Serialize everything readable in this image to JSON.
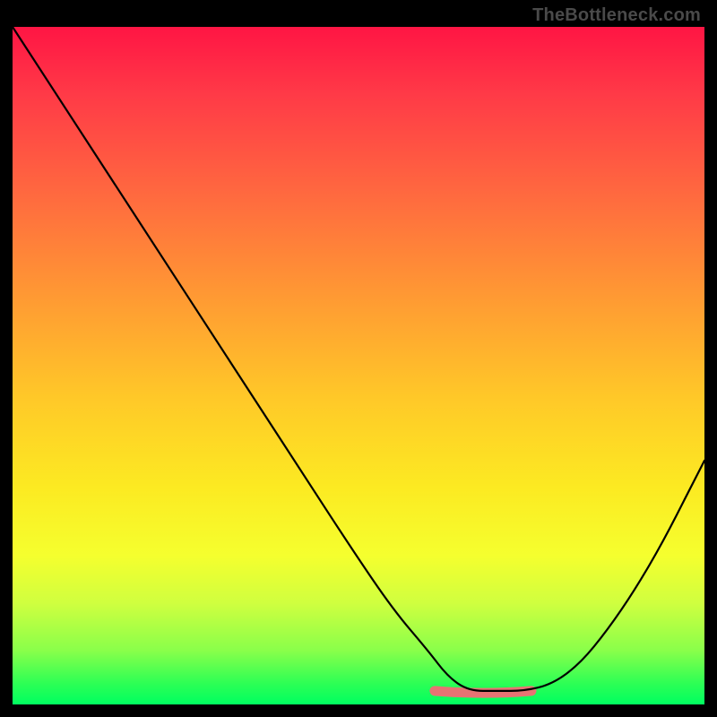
{
  "brand": "TheBottleneck.com",
  "colors": {
    "gradient_top": "#ff1544",
    "gradient_mid1": "#ff9a33",
    "gradient_mid2": "#fcea22",
    "gradient_bottom": "#00ff60",
    "curve": "#000000",
    "highlight_segment": "#e77373",
    "frame": "#000000"
  },
  "chart_data": {
    "type": "line",
    "title": "",
    "xlabel": "",
    "ylabel": "",
    "xlim": [
      0,
      100
    ],
    "ylim": [
      0,
      100
    ],
    "grid": false,
    "legend": false,
    "series": [
      {
        "name": "bottleneck-curve",
        "x": [
          0,
          7,
          14,
          21,
          28,
          35,
          42,
          49,
          55,
          60,
          63,
          66,
          70,
          74,
          78,
          82,
          86,
          90,
          94,
          98,
          100
        ],
        "values": [
          100,
          89,
          78,
          67,
          56,
          45,
          34,
          23,
          14,
          8,
          4,
          2,
          2,
          2,
          3,
          6,
          11,
          17,
          24,
          32,
          36
        ]
      }
    ],
    "annotations": [
      {
        "name": "highlight-optimal-range",
        "x_start": 61,
        "x_end": 75,
        "y": 2,
        "color": "#e77373"
      }
    ]
  }
}
